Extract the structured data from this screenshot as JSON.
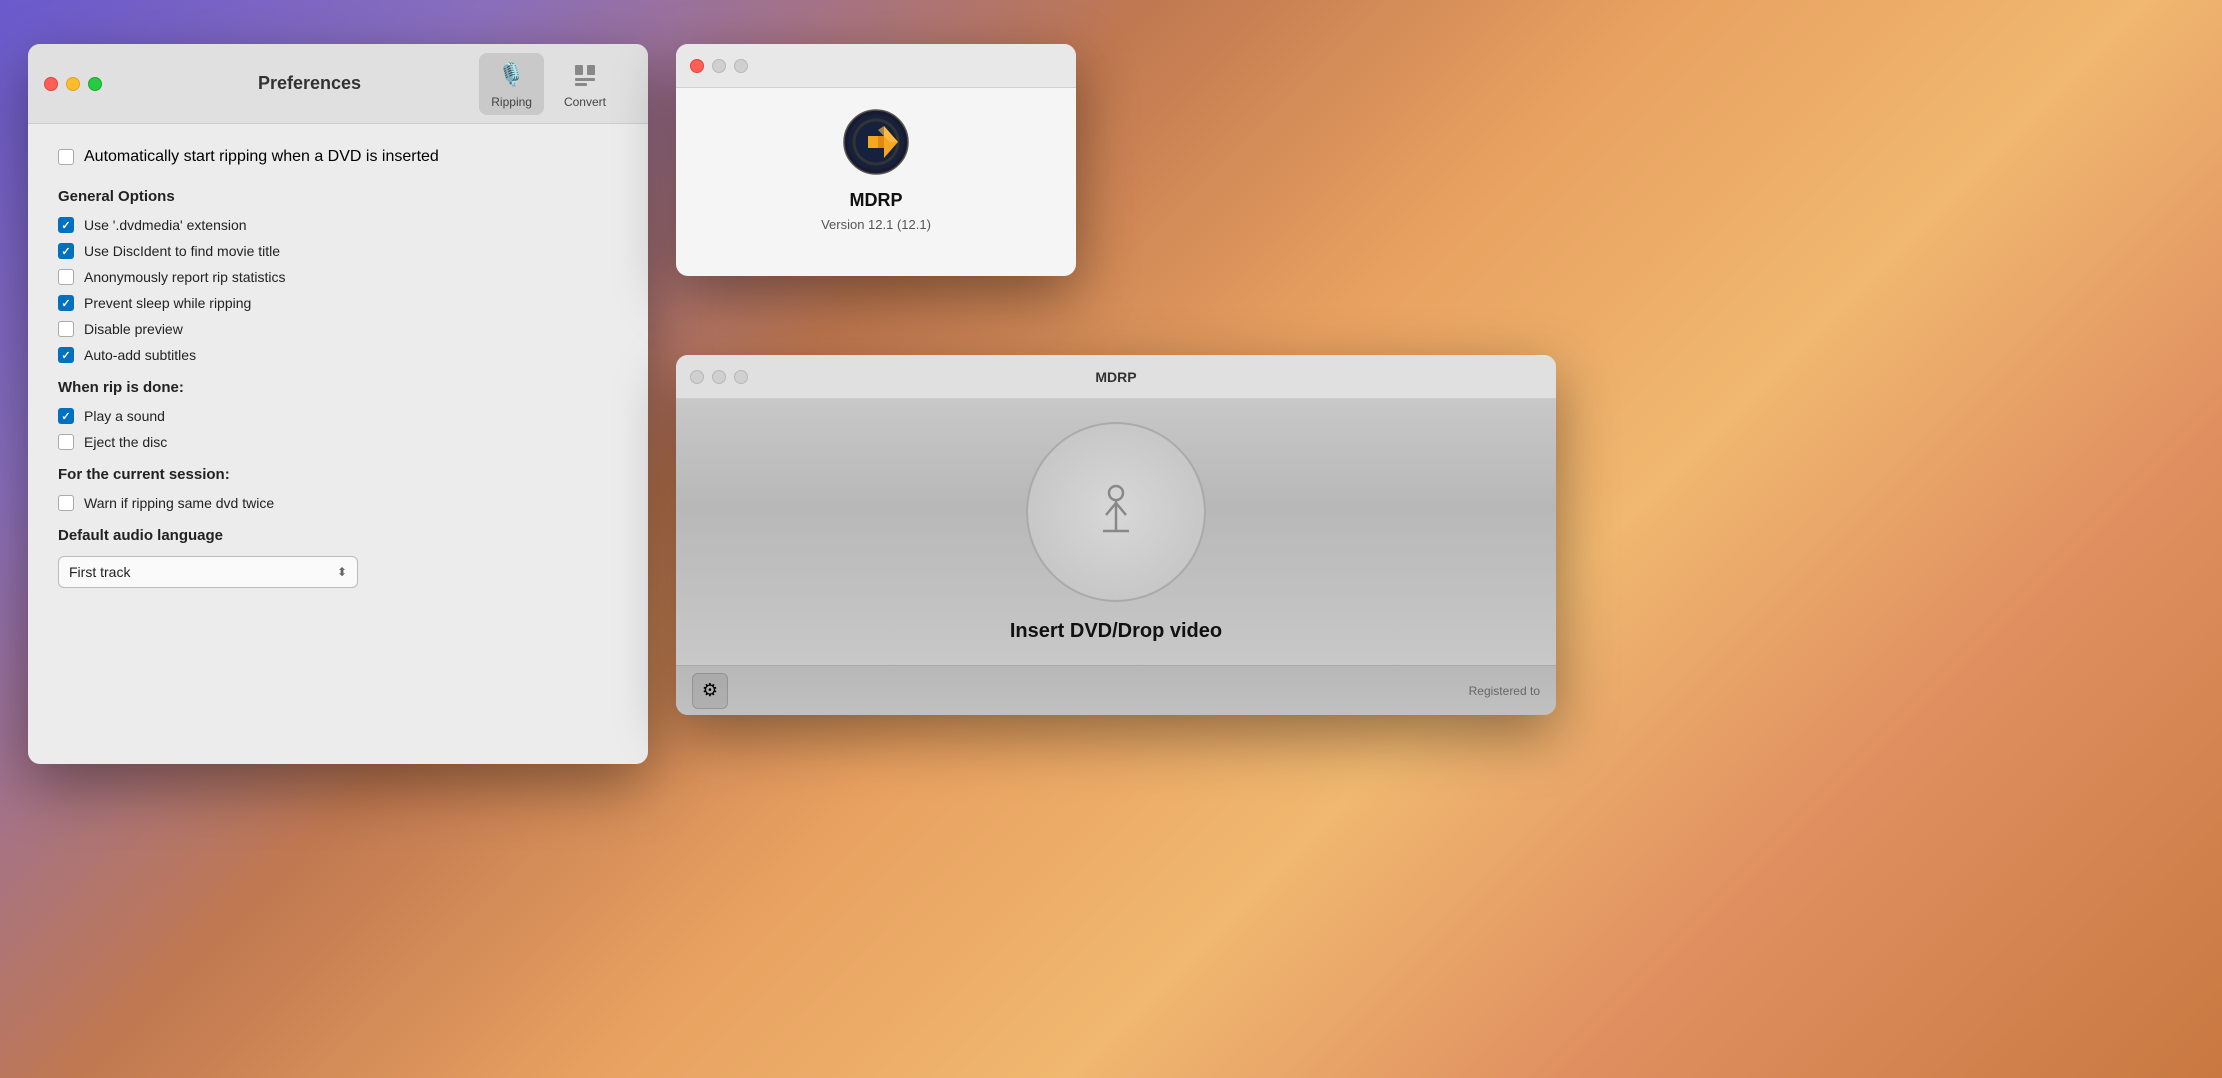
{
  "background": {
    "description": "macOS gradient wallpaper"
  },
  "preferences_window": {
    "title": "Preferences",
    "toolbar": {
      "ripping_label": "Ripping",
      "convert_label": "Convert"
    },
    "auto_start": {
      "label": "Automatically start ripping when a DVD is inserted",
      "checked": false
    },
    "general_options": {
      "heading": "General Options",
      "items": [
        {
          "label": "Use '.dvdmedia' extension",
          "checked": true
        },
        {
          "label": "Use DiscIdent to find movie title",
          "checked": true
        },
        {
          "label": "Anonymously report rip statistics",
          "checked": false
        },
        {
          "label": "Prevent sleep while ripping",
          "checked": true
        },
        {
          "label": "Disable preview",
          "checked": false
        },
        {
          "label": "Auto-add subtitles",
          "checked": true
        }
      ]
    },
    "when_rip_done": {
      "heading": "When rip is done:",
      "items": [
        {
          "label": "Play a sound",
          "checked": true
        },
        {
          "label": "Eject the disc",
          "checked": false
        }
      ]
    },
    "current_session": {
      "heading": "For the current session:",
      "items": [
        {
          "label": "Warn if ripping same dvd twice",
          "checked": false
        }
      ]
    },
    "default_audio": {
      "heading": "Default audio language",
      "selected": "First track"
    }
  },
  "about_window": {
    "title": "",
    "app_name": "MDRP",
    "version": "Version 12.1 (12.1)"
  },
  "main_window": {
    "title": "MDRP",
    "insert_text": "Insert DVD/Drop video",
    "registered_text": "Registered to"
  },
  "icons": {
    "ripping": "🎙",
    "convert": "🗂",
    "gear": "⚙"
  }
}
